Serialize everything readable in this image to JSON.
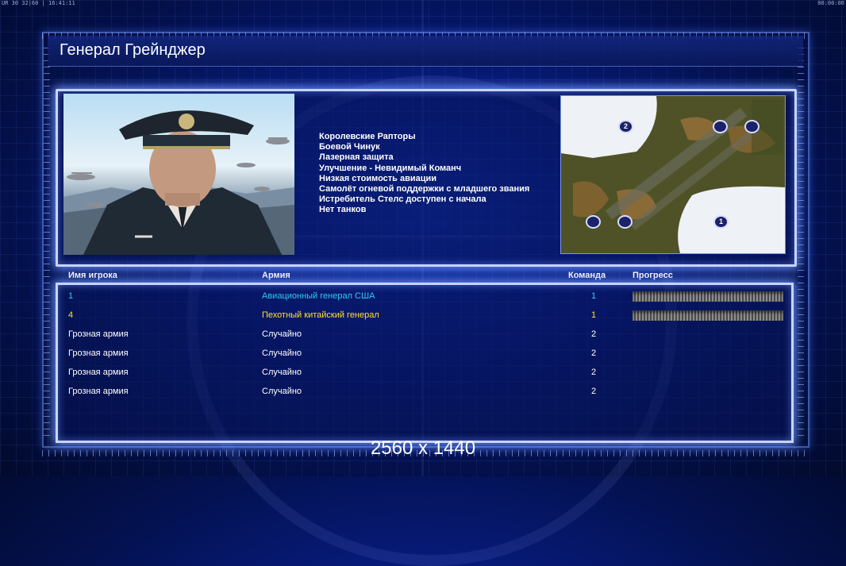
{
  "topbar": {
    "left": "UR 30 32|60 | 16:41:11",
    "right": "00:00:00"
  },
  "title": "Генерал Грейнджер",
  "features": [
    "Королевские Рапторы",
    "Боевой Чинук",
    "Лазерная защита",
    "Улучшение - Невидимый Команч",
    "Низкая стоимость авиации",
    "Самолёт огневой поддержки с младшего звания",
    "Истребитель Стелс доступен с начала",
    "Нет танков"
  ],
  "map": {
    "start_positions": [
      "2",
      "",
      "",
      "",
      "",
      "1"
    ]
  },
  "table": {
    "headers": {
      "name": "Имя игрока",
      "army": "Армия",
      "team": "Команда",
      "progress": "Прогресс"
    },
    "rows": [
      {
        "name": "1",
        "army": "Авиационный генерал США",
        "team": "1",
        "color": "#33c9f5",
        "progress": 1.0
      },
      {
        "name": "4",
        "army": "Пехотный китайский генерал",
        "team": "1",
        "color": "#ffe02a",
        "progress": 1.0
      },
      {
        "name": "Грозная армия",
        "army": "Случайно",
        "team": "2",
        "color": "#ffffff"
      },
      {
        "name": "Грозная армия",
        "army": "Случайно",
        "team": "2",
        "color": "#ffffff"
      },
      {
        "name": "Грозная армия",
        "army": "Случайно",
        "team": "2",
        "color": "#ffffff"
      },
      {
        "name": "Грозная армия",
        "army": "Случайно",
        "team": "2",
        "color": "#ffffff"
      }
    ]
  },
  "resolution_label": "2560 x 1440"
}
